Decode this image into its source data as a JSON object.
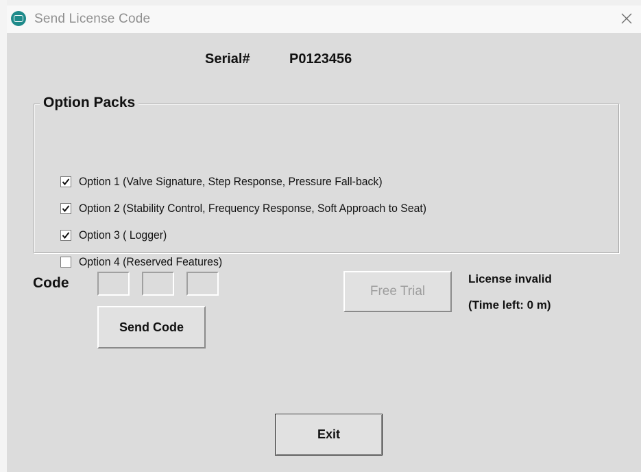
{
  "window": {
    "title": "Send License Code",
    "close_glyph": "✕"
  },
  "serial": {
    "label": "Serial#",
    "value": "P0123456"
  },
  "option_packs": {
    "title": "Option Packs",
    "options": [
      {
        "label": "Option 1 (Valve Signature, Step Response, Pressure Fall-back)",
        "checked": true
      },
      {
        "label": "Option 2 (Stability Control, Frequency Response, Soft Approach to Seat)",
        "checked": true
      },
      {
        "label": "Option 3 ( Logger)",
        "checked": true
      },
      {
        "label": "Option 4 (Reserved Features)",
        "checked": false
      }
    ]
  },
  "code": {
    "label": "Code",
    "fields": [
      "",
      "",
      ""
    ]
  },
  "buttons": {
    "send_code": "Send Code",
    "free_trial": "Free Trial",
    "exit": "Exit"
  },
  "license": {
    "status": "License invalid",
    "time_left": "(Time left: 0 m)"
  },
  "colors": {
    "client_bg": "#dcdcdc",
    "disabled_text": "#9d9d9d",
    "icon_teal": "#1e8a8a"
  },
  "icons": {
    "app": "app-logo-icon",
    "close": "close-icon",
    "check": "checkmark-icon"
  }
}
